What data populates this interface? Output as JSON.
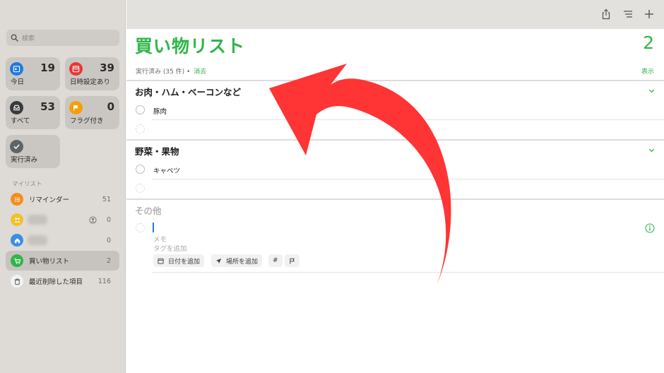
{
  "sidebar": {
    "search_placeholder": "検索",
    "smart_lists": [
      {
        "label": "今日",
        "count": "19",
        "icon": "calendar-icon",
        "color": "#1f7ae0"
      },
      {
        "label": "日時設定あり",
        "count": "39",
        "icon": "calendar-grid-icon",
        "color": "#e53935"
      },
      {
        "label": "すべて",
        "count": "53",
        "icon": "tray-icon",
        "color": "#3a3a3c"
      },
      {
        "label": "フラグ付き",
        "count": "0",
        "icon": "flag-icon",
        "color": "#f59e0b"
      },
      {
        "label": "実行済み",
        "icon": "checkmark-icon",
        "color": "#5f6468"
      }
    ],
    "my_lists_header": "マイリスト",
    "lists": [
      {
        "label": "リマインダー",
        "count": "51",
        "icon": "list-bullet-icon",
        "color": "#f58d1f"
      },
      {
        "label": "",
        "count": "0",
        "icon": "people-icon",
        "color": "#f2c12e"
      },
      {
        "label": "",
        "count": "0",
        "icon": "house-icon",
        "color": "#3c8fe0"
      },
      {
        "label": "買い物リスト",
        "count": "2",
        "icon": "cart-icon",
        "color": "#2fb548"
      },
      {
        "label": "最近削除した項目",
        "count": "116",
        "icon": "trash-icon",
        "color": "#8e8e93"
      }
    ]
  },
  "toolbar": {
    "share_icon": "share-icon",
    "format_icon": "list-format-icon",
    "add_icon": "plus-icon"
  },
  "main": {
    "title": "買い物リスト",
    "count": "2",
    "completed_text": "実行済み (35 件) •",
    "clear_label": "消去",
    "show_label": "表示",
    "accent_color": "#2fb548",
    "sections": [
      {
        "title": "お肉・ハム・ベーコンなど",
        "items": [
          "豚肉"
        ]
      },
      {
        "title": "野菜・果物",
        "items": [
          "キャベツ"
        ]
      },
      {
        "title": "その他",
        "items": []
      }
    ],
    "new_item": {
      "notes_placeholder": "メモ",
      "tags_placeholder": "タグを追加",
      "add_date_label": "日付を追加",
      "add_location_label": "場所を追加",
      "tag_chip": "#",
      "flag_chip_icon": "flag-icon"
    }
  }
}
